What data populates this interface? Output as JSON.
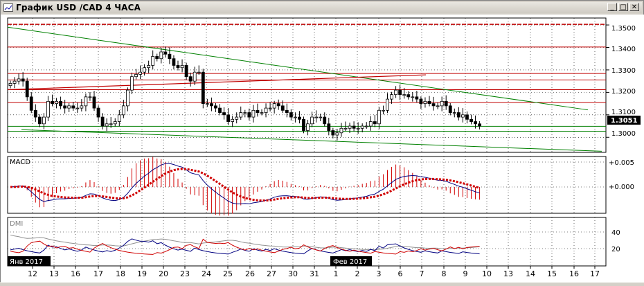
{
  "window": {
    "title": "График USD /CAD  4 ЧАСА",
    "minimize_label": "_",
    "maximize_label": "□",
    "close_label": "✕",
    "icon": "chart-window-icon"
  },
  "chart_data": [
    {
      "type": "candlestick",
      "panel": "price",
      "y_ticks": [
        "1.3500",
        "1.3400",
        "1.3300",
        "1.3200",
        "1.3100",
        "1.3000"
      ],
      "ylim": [
        1.2933,
        1.3531
      ],
      "current_price": "1.3051",
      "close": [
        1.324,
        1.325,
        1.326,
        1.325,
        1.318,
        1.312,
        1.309,
        1.306,
        1.309,
        1.316,
        1.315,
        1.316,
        1.314,
        1.313,
        1.314,
        1.313,
        1.313,
        1.314,
        1.318,
        1.318,
        1.313,
        1.309,
        1.305,
        1.306,
        1.306,
        1.307,
        1.31,
        1.314,
        1.321,
        1.327,
        1.328,
        1.329,
        1.331,
        1.332,
        1.336,
        1.335,
        1.338,
        1.337,
        1.335,
        1.332,
        1.331,
        1.332,
        1.327,
        1.325,
        1.329,
        1.329,
        1.315,
        1.315,
        1.314,
        1.313,
        1.311,
        1.31,
        1.307,
        1.308,
        1.309,
        1.311,
        1.311,
        1.309,
        1.312,
        1.311,
        1.311,
        1.313,
        1.313,
        1.315,
        1.314,
        1.312,
        1.311,
        1.309,
        1.309,
        1.308,
        1.303,
        1.306,
        1.309,
        1.309,
        1.309,
        1.306,
        1.303,
        1.301,
        1.302,
        1.304,
        1.304,
        1.305,
        1.304,
        1.304,
        1.305,
        1.305,
        1.307,
        1.306,
        1.312,
        1.312,
        1.317,
        1.319,
        1.321,
        1.319,
        1.319,
        1.318,
        1.318,
        1.317,
        1.315,
        1.316,
        1.315,
        1.314,
        1.314,
        1.316,
        1.314,
        1.311,
        1.311,
        1.309,
        1.31,
        1.308,
        1.307,
        1.306,
        1.305
      ]
    },
    {
      "type": "line",
      "panel": "MACD",
      "title": "MACD",
      "y_ticks": [
        "+0.005",
        "+0.000"
      ]
    },
    {
      "type": "line",
      "panel": "DMI",
      "title": "DMI",
      "y_ticks": [
        "40",
        "20"
      ]
    }
  ],
  "x_axis": {
    "ticks": [
      "12",
      "13",
      "16",
      "17",
      "18",
      "19",
      "20",
      "23",
      "24",
      "25",
      "26",
      "27",
      "30",
      "31",
      "1",
      "2",
      "3",
      "6",
      "7",
      "8",
      "9",
      "10",
      "13",
      "14",
      "15",
      "16",
      "17"
    ],
    "month_labels": [
      "Янв 2017",
      "Фев 2017"
    ]
  },
  "colors": {
    "bull_candle": "#ffffff",
    "bear_candle": "#000000",
    "resistance_lines": "#c00000",
    "trend_lines": "#008000",
    "macd_line": "#000080",
    "signal_line": "#d00000",
    "histogram": "#d00000",
    "dmi_plus": "#000080",
    "dmi_minus": "#d00000",
    "adx": "#808080"
  }
}
